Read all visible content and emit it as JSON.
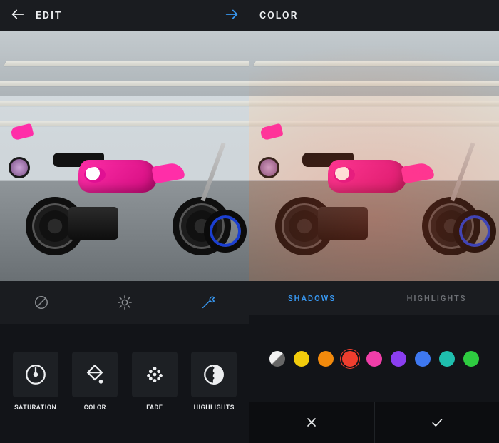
{
  "left": {
    "title": "EDIT",
    "toolstrip": [
      {
        "name": "adjust-icon"
      },
      {
        "name": "brightness-icon"
      },
      {
        "name": "tools-icon",
        "active": true
      }
    ],
    "edits": [
      {
        "name": "saturation",
        "label": "SATURATION"
      },
      {
        "name": "color",
        "label": "COLOR"
      },
      {
        "name": "fade",
        "label": "FADE"
      },
      {
        "name": "highlights",
        "label": "HIGHLIGHTS"
      }
    ]
  },
  "right": {
    "title": "COLOR",
    "tabs": {
      "shadows": "SHADOWS",
      "highlights": "HIGHLIGHTS",
      "active": "shadows"
    },
    "swatches": [
      {
        "name": "none",
        "color": "#ffffff",
        "variant": "hatched"
      },
      {
        "name": "yellow",
        "color": "#f2cc0c"
      },
      {
        "name": "orange",
        "color": "#f28a0c"
      },
      {
        "name": "red",
        "color": "#ef3e2e",
        "selected": true
      },
      {
        "name": "pink",
        "color": "#ef3ea8"
      },
      {
        "name": "purple",
        "color": "#8a3ef0"
      },
      {
        "name": "blue",
        "color": "#3e78f0"
      },
      {
        "name": "teal",
        "color": "#1fbfae"
      },
      {
        "name": "green",
        "color": "#2ecc40"
      }
    ]
  }
}
